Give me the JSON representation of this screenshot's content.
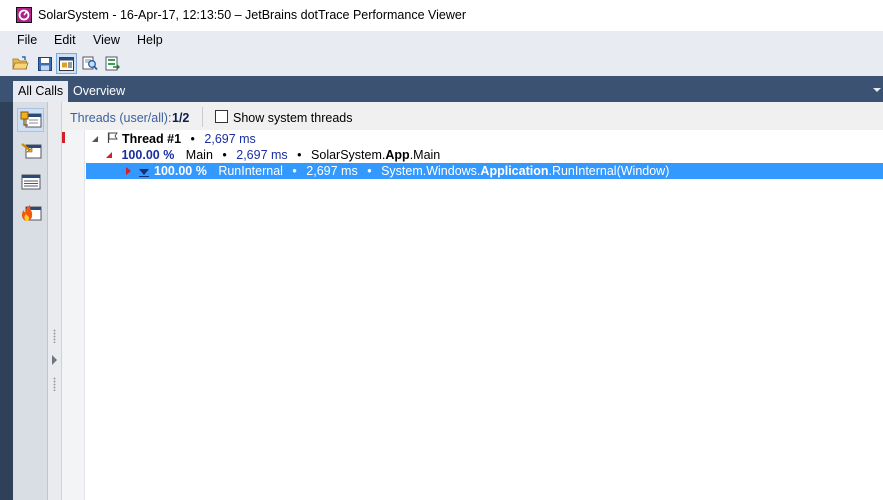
{
  "window": {
    "title": "SolarSystem - 16-Apr-17, 12:13:50 – JetBrains dotTrace Performance Viewer",
    "app_icon": "dottrace-logo-icon"
  },
  "menu": [
    "File",
    "Edit",
    "View",
    "Help"
  ],
  "toolbar": {
    "buttons": [
      "open-folder-icon",
      "save-icon",
      "snapshot-view-icon",
      "find-icon",
      "export-icon"
    ]
  },
  "tabs": [
    {
      "label": "All Calls",
      "active": true
    },
    {
      "label": "Overview",
      "active": false
    }
  ],
  "left_rail": {
    "buttons": [
      "call-tree-view-icon",
      "back-traces-view-icon",
      "plain-list-view-icon",
      "hot-spots-view-icon"
    ]
  },
  "threads": {
    "label": "Threads (user/all):",
    "value": "1/2",
    "show_system_label": "Show system threads",
    "show_system_checked": false
  },
  "tree": {
    "rows": [
      {
        "name": "Thread #1",
        "time": "2,697 ms",
        "sep": "•"
      },
      {
        "pct": "100.00 %",
        "name": "Main",
        "time": "2,697 ms",
        "sep": "•",
        "ns": "SolarSystem.",
        "cls": "App",
        "method": ".Main"
      },
      {
        "pct": "100.00 %",
        "name": "RunInternal",
        "time": "2,697 ms",
        "sep": "•",
        "ns": "System.Windows.",
        "cls": "Application",
        "method": ".RunInternal(Window)",
        "selected": true
      }
    ]
  },
  "colors": {
    "selection": "#3399ff",
    "tab_strip": "#3b5273",
    "percent": "#1a2fa0",
    "hot_marker": "#d0202a"
  }
}
